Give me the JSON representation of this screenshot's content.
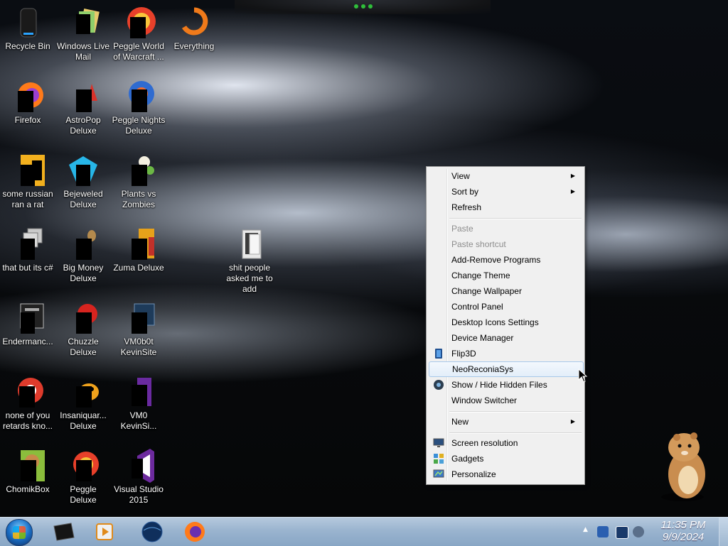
{
  "desktop": {
    "icons": [
      {
        "label": "Recycle Bin",
        "icon": "recycle-bin-icon"
      },
      {
        "label": "Windows Live Mail",
        "icon": "mail-icon"
      },
      {
        "label": "Peggle World of Warcraft ...",
        "icon": "peggle-icon"
      },
      {
        "label": "Everything",
        "icon": "search-icon"
      },
      {
        "label": "Firefox",
        "icon": "firefox-icon"
      },
      {
        "label": "AstroPop Deluxe",
        "icon": "game-icon"
      },
      {
        "label": "Peggle Nights Deluxe",
        "icon": "peggle-icon"
      },
      {
        "label": "some russian ran a rat",
        "icon": "app-icon"
      },
      {
        "label": "Bejeweled Deluxe",
        "icon": "gem-icon"
      },
      {
        "label": "Plants vs Zombies",
        "icon": "flower-icon"
      },
      {
        "label": "that but its c#",
        "icon": "app-icon"
      },
      {
        "label": "Big Money Deluxe",
        "icon": "money-bag-icon"
      },
      {
        "label": "Zuma Deluxe",
        "icon": "game-icon"
      },
      {
        "label": "shit people asked me to add",
        "icon": "folder-icon"
      },
      {
        "label": "Endermanc...",
        "icon": "app-icon"
      },
      {
        "label": "Chuzzle Deluxe",
        "icon": "game-icon"
      },
      {
        "label": "VM0b0t KevinSite",
        "icon": "app-icon"
      },
      {
        "label": "none of you retards kno...",
        "icon": "chrome-icon"
      },
      {
        "label": "Insaniquar... Deluxe",
        "icon": "fish-icon"
      },
      {
        "label": "VM0 KevinSi...",
        "icon": "app-icon"
      },
      {
        "label": "ChomikBox",
        "icon": "hamster-icon"
      },
      {
        "label": "Peggle Deluxe",
        "icon": "peggle-icon"
      },
      {
        "label": "Visual Studio 2015",
        "icon": "visual-studio-icon"
      }
    ]
  },
  "context_menu": {
    "items": [
      {
        "label": "View",
        "submenu": true,
        "disabled": false
      },
      {
        "label": "Sort by",
        "submenu": true,
        "disabled": false
      },
      {
        "label": "Refresh",
        "submenu": false,
        "disabled": false
      },
      {
        "label": "Paste",
        "submenu": false,
        "disabled": true
      },
      {
        "label": "Paste shortcut",
        "submenu": false,
        "disabled": true
      },
      {
        "label": "Add-Remove Programs",
        "submenu": false,
        "disabled": false
      },
      {
        "label": "Change Theme",
        "submenu": false,
        "disabled": false
      },
      {
        "label": "Change Wallpaper",
        "submenu": false,
        "disabled": false
      },
      {
        "label": "Control Panel",
        "submenu": false,
        "disabled": false
      },
      {
        "label": "Desktop Icons Settings",
        "submenu": false,
        "disabled": false
      },
      {
        "label": "Device Manager",
        "submenu": false,
        "disabled": false
      },
      {
        "label": "Flip3D",
        "submenu": false,
        "disabled": false,
        "icon": "flip3d-icon"
      },
      {
        "label": "NeoReconiaSys",
        "submenu": false,
        "disabled": false,
        "hovered": true
      },
      {
        "label": "Show / Hide Hidden Files",
        "submenu": false,
        "disabled": false,
        "icon": "eye-icon"
      },
      {
        "label": "Window Switcher",
        "submenu": false,
        "disabled": false
      },
      {
        "label": "New",
        "submenu": true,
        "disabled": false
      },
      {
        "label": "Screen resolution",
        "submenu": false,
        "disabled": false,
        "icon": "monitor-icon"
      },
      {
        "label": "Gadgets",
        "submenu": false,
        "disabled": false,
        "icon": "gadgets-icon"
      },
      {
        "label": "Personalize",
        "submenu": false,
        "disabled": false,
        "icon": "personalize-icon"
      }
    ],
    "submenu_arrow": "▶"
  },
  "taskbar": {
    "pinned": [
      "terminal-icon",
      "media-player-icon",
      "globe-icon",
      "firefox-icon"
    ],
    "tray_arrow": "▲",
    "tray_icons": [
      "network-icon",
      "display-icon",
      "volume-icon"
    ],
    "clock": {
      "time": "11:35 PM",
      "date": "9/9/2024"
    }
  },
  "colors": {
    "menu_bg": "#f0f0f0",
    "menu_hover": "#dce9f7",
    "taskbar": "#9ab4cf",
    "disabled_text": "#8d8d8d"
  }
}
